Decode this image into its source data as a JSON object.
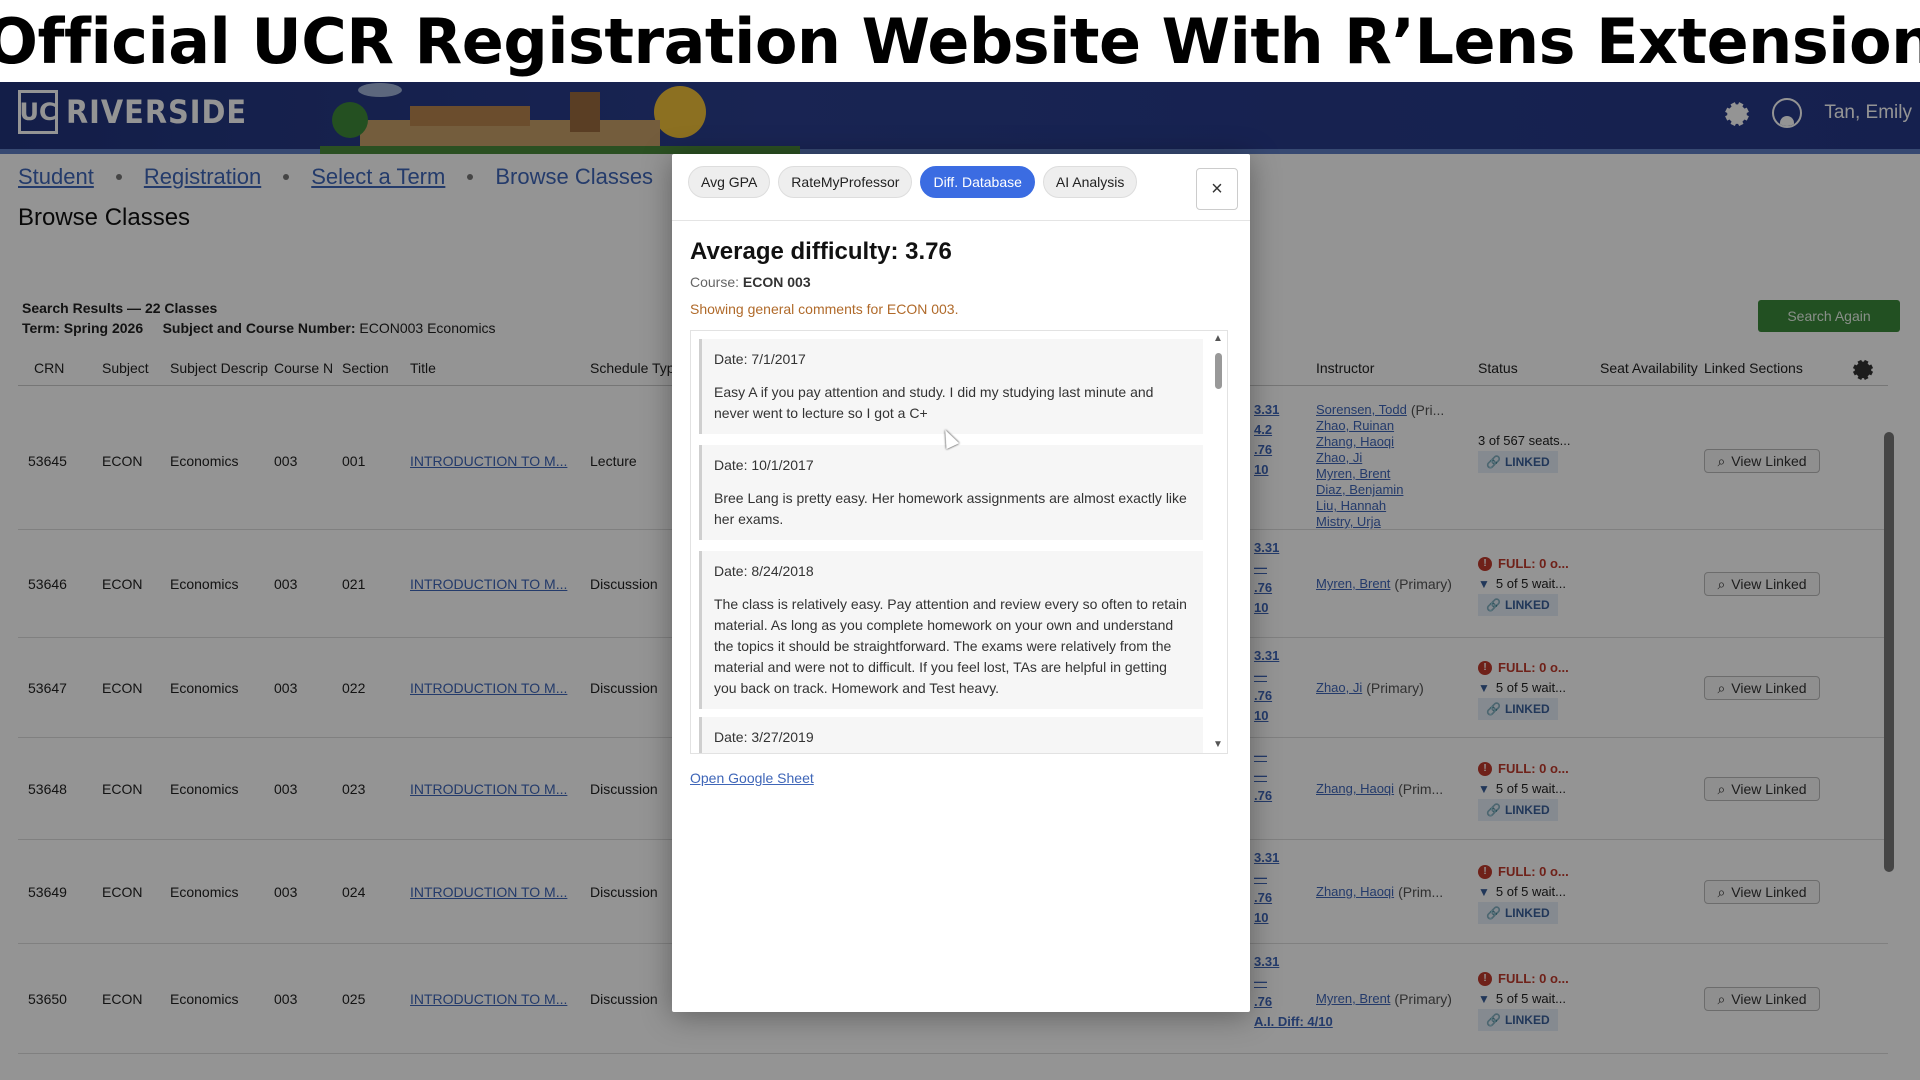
{
  "banner": {
    "title": "Official UCR Registration Website With R’Lens Extension"
  },
  "header": {
    "logo_mark": "UC",
    "logo_name": "RIVERSIDE",
    "user_name": "Tan, Emily"
  },
  "breadcrumb": {
    "items": [
      "Student",
      "Registration",
      "Select a Term",
      "Browse Classes"
    ]
  },
  "page": {
    "title": "Browse Classes"
  },
  "results": {
    "summary": "Search Results — 22 Classes",
    "term_label": "Term: Spring 2026",
    "subject_label": "Subject and Course Number:",
    "subject_value": "ECON003 Economics",
    "search_again": "Search Again"
  },
  "columns": [
    "CRN",
    "Subject",
    "Subject Descrip",
    "Course N",
    "Section",
    "Title",
    "Schedule Typ",
    "Instructor",
    "Status",
    "Seat Availability",
    "Linked Sections"
  ],
  "rows": [
    {
      "crn": "53645",
      "subject": "ECON",
      "desc": "Economics",
      "course": "003",
      "section": "001",
      "title": "INTRODUCTION TO M...",
      "type": "Lecture",
      "gpa": [
        "3.31",
        "4.2",
        ".76",
        "10"
      ],
      "instructors": [
        "Sorensen, Todd",
        "Zhao, Ruinan",
        "Zhang, Haoqi",
        "Zhao, Ji",
        "Myren, Brent",
        "Diaz, Benjamin",
        "Liu, Hannah",
        "Mistry, Urja"
      ],
      "primary": "(Pri...",
      "seats": "3 of 567 seats...",
      "full": "",
      "wait": "",
      "linked": "LINKED",
      "view": "View Linked"
    },
    {
      "crn": "53646",
      "subject": "ECON",
      "desc": "Economics",
      "course": "003",
      "section": "021",
      "title": "INTRODUCTION TO M...",
      "type": "Discussion",
      "gpa": [
        "3.31",
        "—",
        ".76",
        "10"
      ],
      "instructors": [
        "Myren, Brent"
      ],
      "primary": "(Primary)",
      "seats": "",
      "full": "FULL: 0 o...",
      "wait": "5 of 5 wait...",
      "linked": "LINKED",
      "view": "View Linked"
    },
    {
      "crn": "53647",
      "subject": "ECON",
      "desc": "Economics",
      "course": "003",
      "section": "022",
      "title": "INTRODUCTION TO M...",
      "type": "Discussion",
      "gpa": [
        "3.31",
        "—",
        ".76",
        "10"
      ],
      "instructors": [
        "Zhao, Ji"
      ],
      "primary": "(Primary)",
      "seats": "",
      "full": "FULL: 0 o...",
      "wait": "5 of 5 wait...",
      "linked": "LINKED",
      "view": "View Linked"
    },
    {
      "crn": "53648",
      "subject": "ECON",
      "desc": "Economics",
      "course": "003",
      "section": "023",
      "title": "INTRODUCTION TO M...",
      "type": "Discussion",
      "gpa": [
        "—",
        "—",
        ".76",
        ""
      ],
      "instructors": [
        "Zhang, Haoqi"
      ],
      "primary": "(Prim...",
      "seats": "",
      "full": "FULL: 0 o...",
      "wait": "5 of 5 wait...",
      "linked": "LINKED",
      "view": "View Linked"
    },
    {
      "crn": "53649",
      "subject": "ECON",
      "desc": "Economics",
      "course": "003",
      "section": "024",
      "title": "INTRODUCTION TO M...",
      "type": "Discussion",
      "gpa": [
        "3.31",
        "—",
        ".76",
        "10"
      ],
      "instructors": [
        "Zhang, Haoqi"
      ],
      "primary": "(Prim...",
      "seats": "",
      "full": "FULL: 0 o...",
      "wait": "5 of 5 wait...",
      "linked": "LINKED",
      "view": "View Linked"
    },
    {
      "crn": "53650",
      "subject": "ECON",
      "desc": "Economics",
      "course": "003",
      "section": "025",
      "title": "INTRODUCTION TO M...",
      "type": "Discussion",
      "gpa": [
        "3.31",
        "—",
        ".76",
        "A.I. Diff: 4/10"
      ],
      "instructors": [
        "Myren, Brent"
      ],
      "primary": "(Primary)",
      "seats": "",
      "full": "FULL: 0 o...",
      "wait": "5 of 5 wait...",
      "linked": "LINKED",
      "view": "View Linked"
    }
  ],
  "modal": {
    "tabs": [
      "Avg GPA",
      "RateMyProfessor",
      "Diff. Database",
      "AI Analysis"
    ],
    "active_tab": "Diff. Database",
    "close": "×",
    "heading": "Average difficulty: 3.76",
    "course_label": "Course:",
    "course_value": "ECON 003",
    "note": "Showing general comments for ECON 003.",
    "comments": [
      {
        "date": "Date: 7/1/2017",
        "text": "Easy A if you pay attention and study. I did my studying last minute and never went to lecture so I got a C+"
      },
      {
        "date": "Date: 10/1/2017",
        "text": "Bree Lang is pretty easy. Her homework assignments are almost exactly like her exams."
      },
      {
        "date": "Date: 8/24/2018",
        "text": "The class is relatively easy. Pay attention and review every so often to retain material. As long as you complete homework on your own and understand the topics it should be straightforward. The exams were relatively from the material and were not to difficult. If you feel lost, TAs are helpful in getting you back on track. Homework and Test heavy."
      },
      {
        "date": "Date: 3/27/2019",
        "text": ""
      }
    ],
    "link": "Open Google Sheet"
  }
}
